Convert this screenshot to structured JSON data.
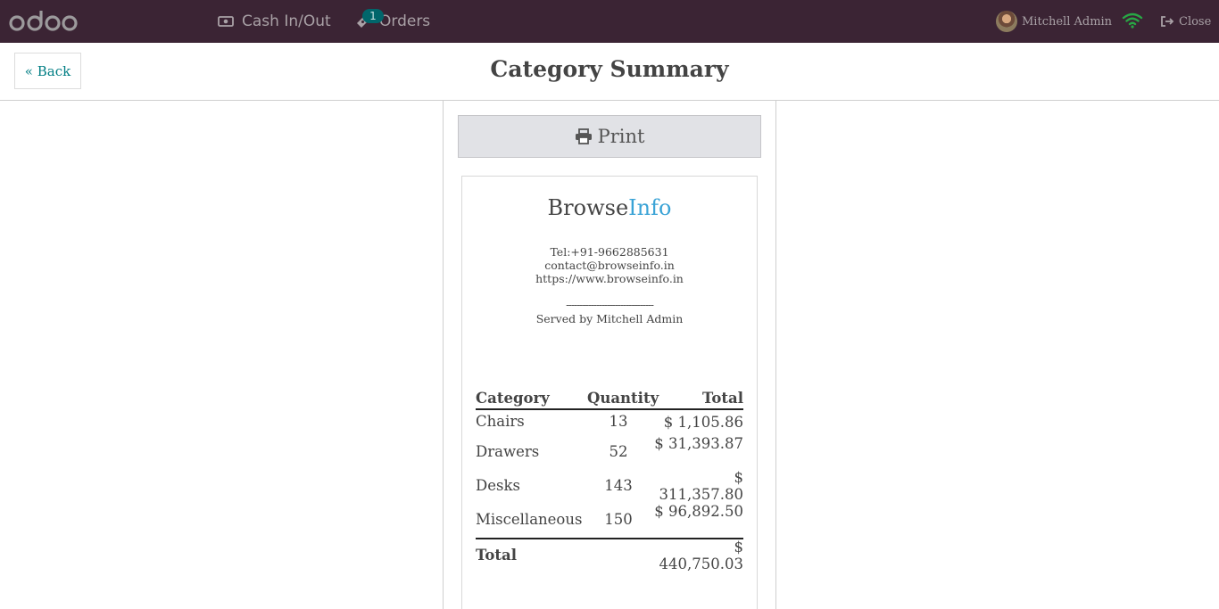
{
  "navbar": {
    "cash_label": "Cash In/Out",
    "orders_label": "Orders",
    "orders_badge": "1",
    "user_name": "Mitchell Admin",
    "close_label": "Close"
  },
  "header": {
    "back_label": "« Back",
    "title": "Category Summary"
  },
  "receipt": {
    "print_label": "Print",
    "brand_a": "Browse",
    "brand_b": "Info",
    "tel": "Tel:+91-9662885631",
    "email": "contact@browseinfo.in",
    "website": "https://www.browseinfo.in",
    "separator": "--------------------------------",
    "served_by": "Served by Mitchell Admin",
    "columns": {
      "category": "Category",
      "quantity": "Quantity",
      "total": "Total"
    },
    "rows": [
      {
        "category": "Chairs",
        "quantity": "13",
        "total": "$ 1,105.86"
      },
      {
        "category": "Drawers",
        "quantity": "52",
        "total": "$ 31,393.87"
      },
      {
        "category": "Desks",
        "quantity": "143",
        "total": "$ 311,357.80"
      },
      {
        "category": "Miscellaneous",
        "quantity": "150",
        "total": "$ 96,892.50"
      }
    ],
    "total_label": "Total",
    "grand_total": "$ 440,750.03"
  },
  "colors": {
    "navbar_bg": "#3b2434",
    "accent": "#017e84",
    "brand_info": "#3aa3d6",
    "wifi": "#28a745"
  },
  "icons": [
    "odoo-logo",
    "money-icon",
    "ticket-icon",
    "wifi-icon",
    "sign-out-icon",
    "print-icon",
    "double-chevron-left-icon"
  ]
}
